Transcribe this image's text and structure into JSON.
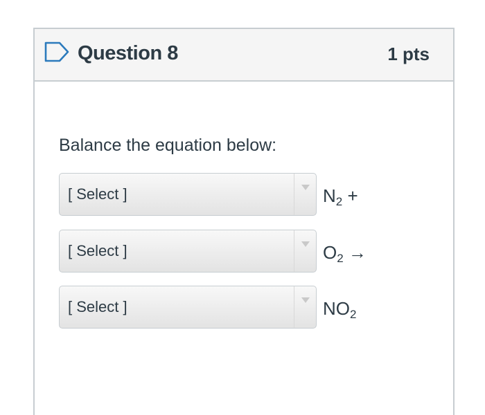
{
  "question": {
    "title": "Question 8",
    "points": "1 pts",
    "text": "Balance the equation below:"
  },
  "rows": [
    {
      "select_value": "[ Select ]",
      "formula_base": "N",
      "formula_sub": "2",
      "formula_suffix": " +"
    },
    {
      "select_value": "[ Select ]",
      "formula_base": "O",
      "formula_sub": "2",
      "formula_suffix": " →"
    },
    {
      "select_value": "[ Select ]",
      "formula_base": "NO",
      "formula_sub": "2",
      "formula_suffix": ""
    }
  ],
  "icons": {
    "flag": "flag-outline-icon",
    "dropdown": "chevron-down-icon"
  },
  "colors": {
    "text": "#2d3b45",
    "border": "#c7cdd1",
    "header_bg": "#f5f5f5",
    "flag_stroke": "#2b7abc"
  }
}
